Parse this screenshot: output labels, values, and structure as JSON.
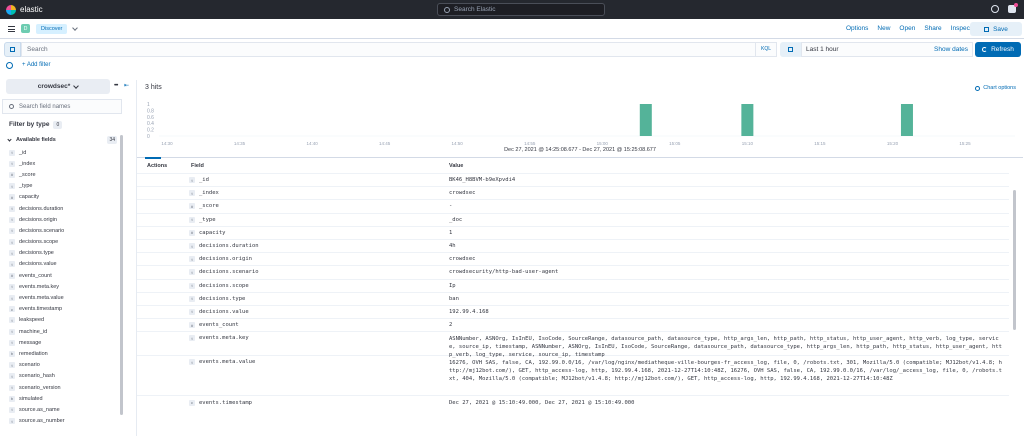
{
  "app": {
    "logo_text": "elastic",
    "global_search_placeholder": "Search Elastic"
  },
  "nav": {
    "space_initial": "D",
    "breadcrumb": "Discover",
    "links": [
      "Options",
      "New",
      "Open",
      "Share",
      "Inspect"
    ],
    "save_label": "Save"
  },
  "query": {
    "placeholder": "Search",
    "language": "KQL",
    "time_range": "Last 1 hour",
    "show_dates": "Show dates",
    "refresh_label": "Refresh"
  },
  "filter": {
    "add_label": "+ Add filter"
  },
  "sidebar": {
    "index_pattern": "crowdsec*",
    "field_search_placeholder": "Search field names",
    "filter_by_type": "Filter by type",
    "filter_badge": "0",
    "available_label": "Available fields",
    "available_count": "34",
    "fields": [
      {
        "type": "t",
        "name": "_id"
      },
      {
        "type": "t",
        "name": "_index"
      },
      {
        "type": "#",
        "name": "_score"
      },
      {
        "type": "t",
        "name": "_type"
      },
      {
        "type": "#",
        "name": "capacity"
      },
      {
        "type": "t",
        "name": "decisions.duration"
      },
      {
        "type": "t",
        "name": "decisions.origin"
      },
      {
        "type": "t",
        "name": "decisions.scenario"
      },
      {
        "type": "t",
        "name": "decisions.scope"
      },
      {
        "type": "t",
        "name": "decisions.type"
      },
      {
        "type": "t",
        "name": "decisions.value"
      },
      {
        "type": "#",
        "name": "events_count"
      },
      {
        "type": "t",
        "name": "events.meta.key"
      },
      {
        "type": "t",
        "name": "events.meta.value"
      },
      {
        "type": "c",
        "name": "events.timestamp"
      },
      {
        "type": "t",
        "name": "leakspeed"
      },
      {
        "type": "t",
        "name": "machine_id"
      },
      {
        "type": "t",
        "name": "message"
      },
      {
        "type": "b",
        "name": "remediation"
      },
      {
        "type": "t",
        "name": "scenario"
      },
      {
        "type": "t",
        "name": "scenario_hash"
      },
      {
        "type": "t",
        "name": "scenario_version"
      },
      {
        "type": "b",
        "name": "simulated"
      },
      {
        "type": "t",
        "name": "source.as_name"
      },
      {
        "type": "t",
        "name": "source.as_number"
      }
    ]
  },
  "results": {
    "hits_label": "3 hits",
    "chart_options": "Chart options",
    "caption": "Dec 27, 2021 @ 14:25:08.677 - Dec 27, 2021 @ 15:25:08.677",
    "columns": {
      "actions": "Actions",
      "field": "Field",
      "value": "Value"
    },
    "rows": [
      {
        "type": "t",
        "field": "_id",
        "value": "BK46_H8BVM-b9eXpvdi4"
      },
      {
        "type": "t",
        "field": "_index",
        "value": "crowdsec"
      },
      {
        "type": "#",
        "field": "_score",
        "value": "-"
      },
      {
        "type": "t",
        "field": "_type",
        "value": "_doc"
      },
      {
        "type": "#",
        "field": "capacity",
        "value": "1"
      },
      {
        "type": "t",
        "field": "decisions.duration",
        "value": "4h"
      },
      {
        "type": "t",
        "field": "decisions.origin",
        "value": "crowdsec"
      },
      {
        "type": "t",
        "field": "decisions.scenario",
        "value": "crowdsecurity/http-bad-user-agent"
      },
      {
        "type": "t",
        "field": "decisions.scope",
        "value": "Ip"
      },
      {
        "type": "t",
        "field": "decisions.type",
        "value": "ban"
      },
      {
        "type": "t",
        "field": "decisions.value",
        "value": "192.99.4.168"
      },
      {
        "type": "#",
        "field": "events_count",
        "value": "2"
      },
      {
        "type": "t",
        "field": "events.meta.key",
        "value": "ASNNumber, ASNOrg, IsInEU, IsoCode, SourceRange, datasource_path, datasource_type, http_args_len, http_path, http_status, http_user_agent, http_verb, log_type, service, source_ip, timestamp, ASNNumber, ASNOrg, IsInEU, IsoCode, SourceRange, datasource_path, datasource_type, http_args_len, http_path, http_status, http_user_agent, http_verb, log_type, service, source_ip, timestamp"
      },
      {
        "type": "t",
        "field": "events.meta.value",
        "value": "16276, OVH SAS, false, CA, 192.99.0.0/16, /var/log/nginx/mediatheque-ville-bourges-fr_access_log, file, 0, /robots.txt, 301, Mozilla/5.0 (compatible; MJ12bot/v1.4.8; http://mj12bot.com/), GET, http_access-log, http, 192.99.4.168, 2021-12-27T14:10:48Z, 16276, OVH SAS, false, CA, 192.99.0.0/16, /var/log/_access_log, file, 0, /robots.txt, 404, Mozilla/5.0 (compatible; MJ12bot/v1.4.8; http://mj12bot.com/), GET, http_access-log, http, 192.99.4.168, 2021-12-27T14:10:48Z"
      },
      {
        "type": "c",
        "field": "events.timestamp",
        "value": "Dec 27, 2021 @ 15:10:49.000, Dec 27, 2021 @ 15:10:49.000"
      }
    ]
  },
  "chart_data": {
    "type": "bar",
    "title": "",
    "xlabel": "",
    "ylabel": "",
    "x_ticks": [
      "14:30",
      "14:35",
      "14:40",
      "14:45",
      "14:50",
      "14:55",
      "15:00",
      "15:05",
      "15:10",
      "15:15",
      "15:20",
      "15:25"
    ],
    "y_ticks": [
      0,
      0.2,
      0.4,
      0.6,
      0.8,
      1
    ],
    "ylim": [
      0,
      1
    ],
    "bars": [
      {
        "x": "15:03",
        "value": 1
      },
      {
        "x": "15:10",
        "value": 1
      },
      {
        "x": "15:21",
        "value": 1
      }
    ],
    "color": "#54b399",
    "grid": false
  }
}
